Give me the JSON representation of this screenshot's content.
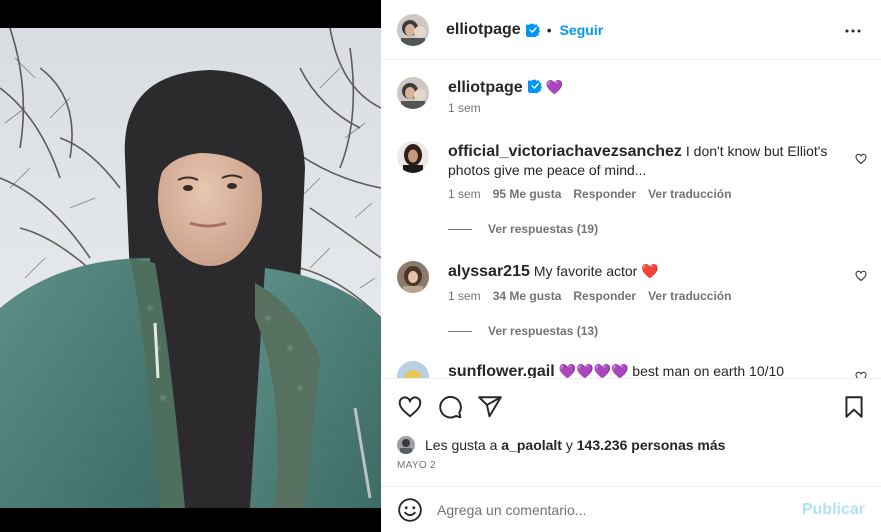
{
  "post": {
    "author": "elliotpage",
    "follow_label": "Seguir",
    "dot": "•",
    "caption_emoji": "💜",
    "caption_time": "1 sem"
  },
  "comments": [
    {
      "user": "official_victoriachavezsanchez",
      "text": "I don't know but Elliot's photos give me peace of mind...",
      "time": "1 sem",
      "likes": "95 Me gusta",
      "reply_label": "Responder",
      "translate_label": "Ver traducción",
      "replies_label": "Ver respuestas (19)"
    },
    {
      "user": "alyssar215",
      "text": "My favorite actor ❤️",
      "time": "1 sem",
      "likes": "34 Me gusta",
      "reply_label": "Responder",
      "translate_label": "Ver traducción",
      "replies_label": "Ver respuestas (13)"
    },
    {
      "user": "sunflower.gail",
      "text": "💜💜💜💜 best man on earth 10/10"
    }
  ],
  "likes": {
    "prefix": "Les gusta a",
    "user": "a_paolalt",
    "middle": "y",
    "count": "143.236 personas más"
  },
  "date": "MAYO 2",
  "composer": {
    "placeholder": "Agrega un comentario...",
    "publish_label": "Publicar"
  },
  "colors": {
    "accent": "#0095f6",
    "publish_disabled": "#b2dffc",
    "text": "#262626",
    "muted": "#737373"
  },
  "icons": [
    "verified-badge-icon",
    "more-options-icon",
    "heart-icon",
    "comment-icon",
    "share-icon",
    "bookmark-icon",
    "emoji-icon"
  ]
}
